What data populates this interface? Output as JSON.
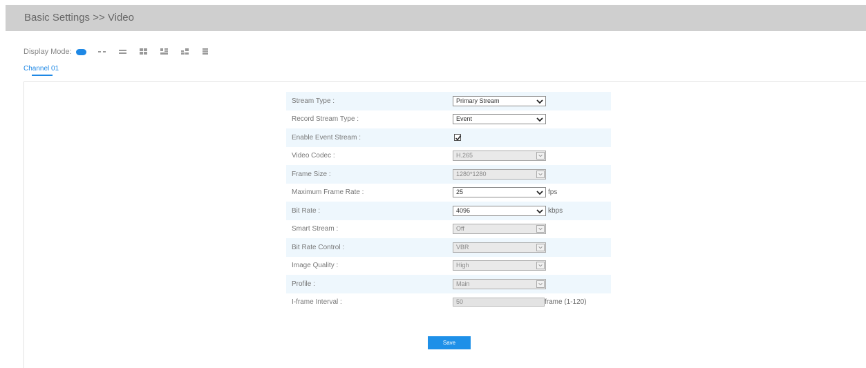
{
  "header": {
    "title": "Basic Settings >> Video"
  },
  "display": {
    "label": "Display Mode:",
    "modes": [
      "mode-single-icon",
      "mode-2-icon",
      "mode-3-icon",
      "mode-4-icon",
      "mode-5-icon",
      "mode-6-icon",
      "mode-7-icon"
    ]
  },
  "channel": {
    "tab": "Channel 01"
  },
  "form": {
    "stream_type": {
      "label": "Stream Type :",
      "value": "Primary Stream"
    },
    "record_stream_type": {
      "label": "Record Stream Type :",
      "value": "Event"
    },
    "enable_event_stream": {
      "label": "Enable Event Stream :",
      "checked": true
    },
    "video_codec": {
      "label": "Video Codec :",
      "value": "H.265"
    },
    "frame_size": {
      "label": "Frame Size :",
      "value": "1280*1280"
    },
    "max_frame_rate": {
      "label": "Maximum Frame Rate :",
      "value": "25",
      "unit": "fps"
    },
    "bit_rate": {
      "label": "Bit Rate :",
      "value": "4096",
      "unit": "kbps"
    },
    "smart_stream": {
      "label": "Smart Stream :",
      "value": "Off"
    },
    "bit_rate_control": {
      "label": "Bit Rate Control :",
      "value": "VBR"
    },
    "image_quality": {
      "label": "Image Quality :",
      "value": "High"
    },
    "profile": {
      "label": "Profile :",
      "value": "Main"
    },
    "iframe_interval": {
      "label": "I-frame Interval :",
      "value": "50",
      "unit": "frame (1-120)"
    }
  },
  "save_label": "Save",
  "colors": {
    "accent": "#1e88e5",
    "row_alt": "#eef7fd",
    "header_bg": "#cfcfcf"
  }
}
